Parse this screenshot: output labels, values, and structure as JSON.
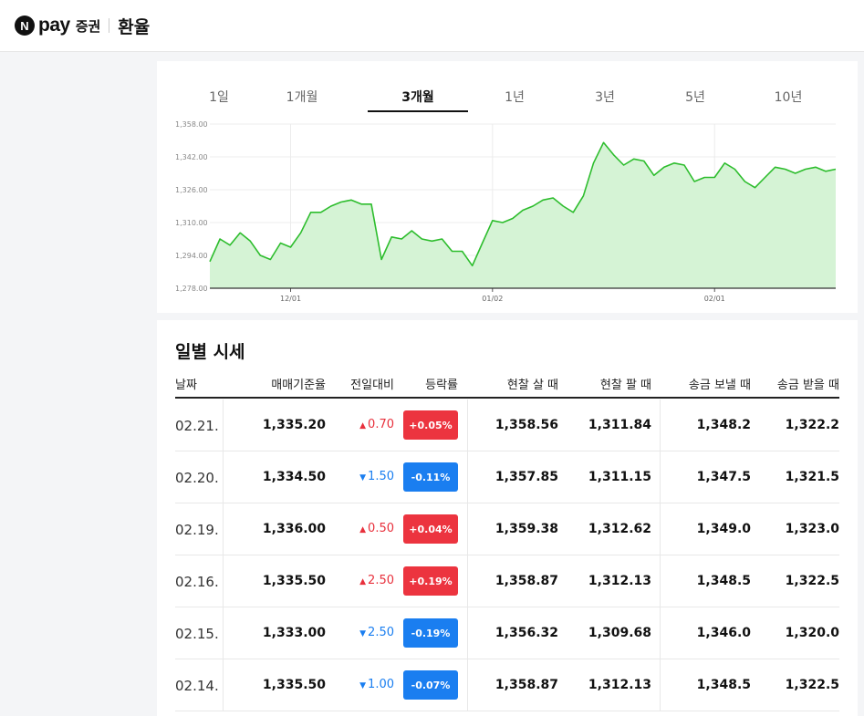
{
  "header": {
    "logo_n": "N",
    "logo_pay": "pay",
    "logo_sec": "증권",
    "title": "환율"
  },
  "tabs": [
    {
      "label": "1일",
      "active": false
    },
    {
      "label": "1개월",
      "active": false
    },
    {
      "label": "3개월",
      "active": true
    },
    {
      "label": "1년",
      "active": false
    },
    {
      "label": "3년",
      "active": false
    },
    {
      "label": "5년",
      "active": false
    },
    {
      "label": "10년",
      "active": false
    }
  ],
  "chart_data": {
    "type": "area",
    "ylim": [
      1278,
      1358
    ],
    "y_ticks": [
      "1,358.00",
      "1,342.00",
      "1,326.00",
      "1,310.00",
      "1,294.00",
      "1,278.00"
    ],
    "x_ticks": [
      {
        "label": "12/01",
        "index": 8
      },
      {
        "label": "01/02",
        "index": 28
      },
      {
        "label": "02/01",
        "index": 50
      }
    ],
    "line_color": "#2dbd2d",
    "fill_color": "#d5f3d5",
    "values": [
      1291,
      1302,
      1299,
      1305,
      1301,
      1294,
      1292,
      1300,
      1298,
      1305,
      1315,
      1315,
      1318,
      1320,
      1321,
      1319,
      1319,
      1292,
      1303,
      1302,
      1306,
      1302,
      1301,
      1302,
      1296,
      1296,
      1289,
      1300,
      1311,
      1310,
      1312,
      1316,
      1318,
      1321,
      1322,
      1318,
      1315,
      1323,
      1339,
      1349,
      1343,
      1338,
      1341,
      1340,
      1333,
      1337,
      1339,
      1338,
      1330,
      1332,
      1332,
      1339,
      1336,
      1330,
      1327,
      1332,
      1337,
      1336,
      1334,
      1336,
      1337,
      1335,
      1336
    ]
  },
  "table": {
    "title": "일별 시세",
    "headers": [
      "날짜",
      "매매기준율",
      "전일대비",
      "등락률",
      "현찰 살 때",
      "현찰 팔 때",
      "송금 보낼 때",
      "송금 받을 때"
    ],
    "rows": [
      {
        "date": "02.21.",
        "base": "1,335.20",
        "dir": "up",
        "arrow": "▲",
        "change": "0.70",
        "rate": "+0.05%",
        "cash_buy": "1,358.56",
        "cash_sell": "1,311.84",
        "send": "1,348.2",
        "receive": "1,322.2"
      },
      {
        "date": "02.20.",
        "base": "1,334.50",
        "dir": "down",
        "arrow": "▼",
        "change": "1.50",
        "rate": "-0.11%",
        "cash_buy": "1,357.85",
        "cash_sell": "1,311.15",
        "send": "1,347.5",
        "receive": "1,321.5"
      },
      {
        "date": "02.19.",
        "base": "1,336.00",
        "dir": "up",
        "arrow": "▲",
        "change": "0.50",
        "rate": "+0.04%",
        "cash_buy": "1,359.38",
        "cash_sell": "1,312.62",
        "send": "1,349.0",
        "receive": "1,323.0"
      },
      {
        "date": "02.16.",
        "base": "1,335.50",
        "dir": "up",
        "arrow": "▲",
        "change": "2.50",
        "rate": "+0.19%",
        "cash_buy": "1,358.87",
        "cash_sell": "1,312.13",
        "send": "1,348.5",
        "receive": "1,322.5"
      },
      {
        "date": "02.15.",
        "base": "1,333.00",
        "dir": "down",
        "arrow": "▼",
        "change": "2.50",
        "rate": "-0.19%",
        "cash_buy": "1,356.32",
        "cash_sell": "1,309.68",
        "send": "1,346.0",
        "receive": "1,320.0"
      },
      {
        "date": "02.14.",
        "base": "1,335.50",
        "dir": "down",
        "arrow": "▼",
        "change": "1.00",
        "rate": "-0.07%",
        "cash_buy": "1,358.87",
        "cash_sell": "1,312.13",
        "send": "1,348.5",
        "receive": "1,322.5"
      }
    ]
  }
}
